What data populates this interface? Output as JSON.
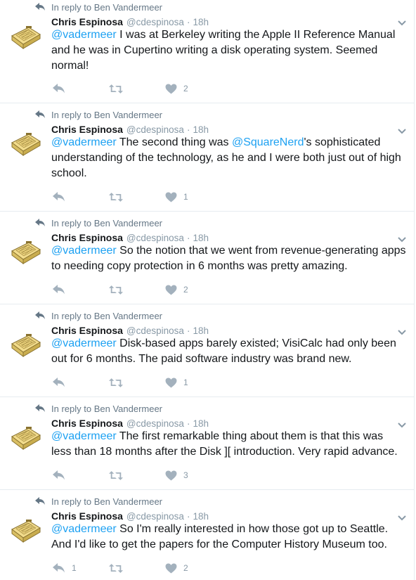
{
  "tweets": [
    {
      "reply_context": "In reply to Ben Vandermeer",
      "name": "Chris Espinosa",
      "handle": "@cdespinosa",
      "time": "18h",
      "mention": "@vadermeer",
      "segments": [
        " I was at Berkeley writing the Apple II Reference Manual and he was in Cupertino writing a disk operating system. Seemed normal!"
      ],
      "replies": "",
      "likes": "2"
    },
    {
      "reply_context": "In reply to Ben Vandermeer",
      "name": "Chris Espinosa",
      "handle": "@cdespinosa",
      "time": "18h",
      "mention": "@vadermeer",
      "segments": [
        " The second thing was ",
        "@SquareNerd",
        "'s sophisticated understanding of the technology, as he and I were both just out of high school."
      ],
      "replies": "",
      "likes": "1"
    },
    {
      "reply_context": "In reply to Ben Vandermeer",
      "name": "Chris Espinosa",
      "handle": "@cdespinosa",
      "time": "18h",
      "mention": "@vadermeer",
      "segments": [
        " So the notion that we went from revenue-generating apps to needing copy protection in 6 months was pretty amazing."
      ],
      "replies": "",
      "likes": "2"
    },
    {
      "reply_context": "In reply to Ben Vandermeer",
      "name": "Chris Espinosa",
      "handle": "@cdespinosa",
      "time": "18h",
      "mention": "@vadermeer",
      "segments": [
        " Disk-based apps barely existed; VisiCalc had only been out for 6 months. The paid software industry was brand new."
      ],
      "replies": "",
      "likes": "1"
    },
    {
      "reply_context": "In reply to Ben Vandermeer",
      "name": "Chris Espinosa",
      "handle": "@cdespinosa",
      "time": "18h",
      "mention": "@vadermeer",
      "segments": [
        " The first remarkable thing about them is that this was less than 18 months after the Disk ][ introduction. Very rapid advance."
      ],
      "replies": "",
      "likes": "3"
    },
    {
      "reply_context": "In reply to Ben Vandermeer",
      "name": "Chris Espinosa",
      "handle": "@cdespinosa",
      "time": "18h",
      "mention": "@vadermeer",
      "segments": [
        " So I'm really interested in how those got up to Seattle. And I'd like to get the papers for the Computer History Museum too."
      ],
      "replies": "1",
      "likes": "2"
    }
  ],
  "colors": {
    "link": "#1da1f2",
    "meta": "#8899a6",
    "text": "#14171a",
    "divider": "#e6ecf0"
  },
  "icons": {
    "reply_context": "reply-arrow-icon",
    "avatar": "apple-ii-computer-avatar",
    "caret": "chevron-down-icon",
    "reply": "reply-icon",
    "retweet": "retweet-icon",
    "like": "heart-icon"
  }
}
